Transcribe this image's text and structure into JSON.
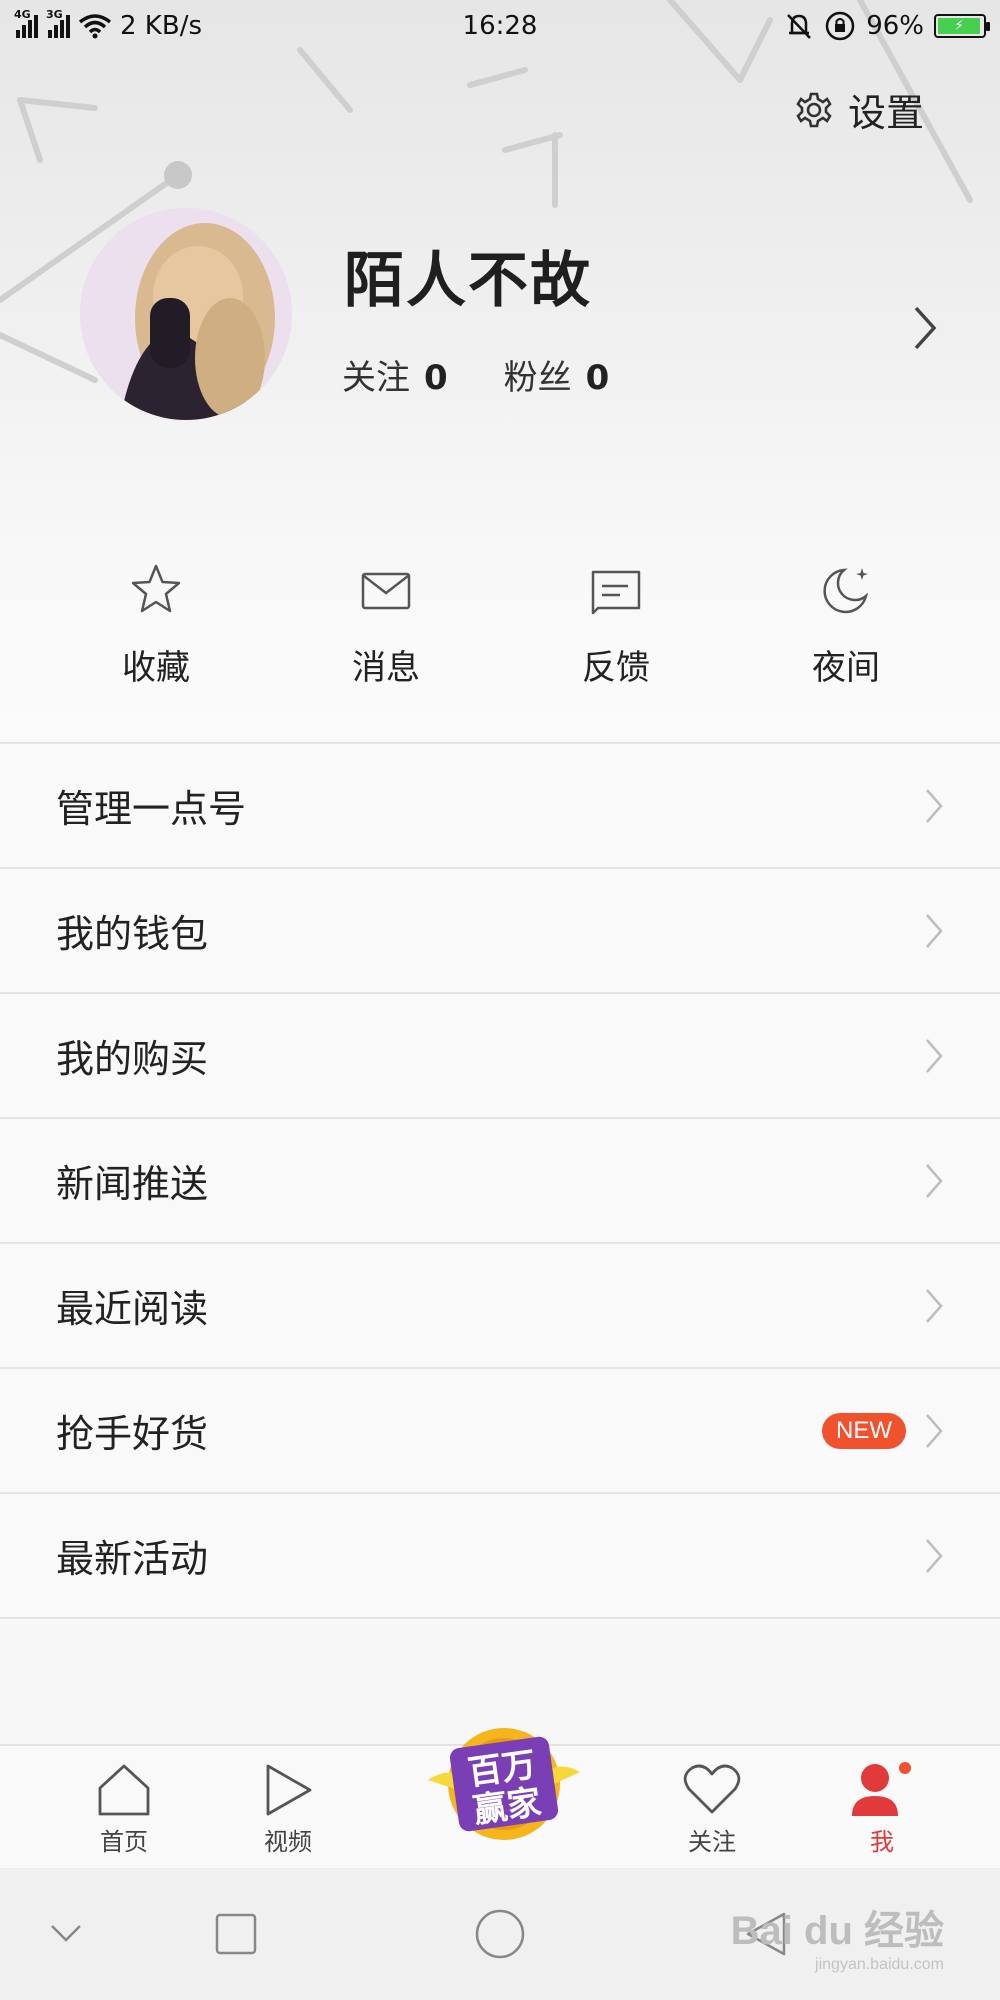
{
  "status_bar": {
    "network_1": "4G",
    "network_2": "3G",
    "speed": "2 KB/s",
    "time": "16:28",
    "battery": "96%"
  },
  "header": {
    "settings_label": "设置"
  },
  "profile": {
    "username": "陌人不故",
    "following_label": "关注",
    "following_count": "0",
    "fans_label": "粉丝",
    "fans_count": "0"
  },
  "quick_actions": [
    {
      "label": "收藏",
      "icon": "star-icon"
    },
    {
      "label": "消息",
      "icon": "mail-icon"
    },
    {
      "label": "反馈",
      "icon": "feedback-icon"
    },
    {
      "label": "夜间",
      "icon": "moon-icon"
    }
  ],
  "menu": [
    {
      "label": "管理一点号"
    },
    {
      "label": "我的钱包"
    },
    {
      "label": "我的购买"
    },
    {
      "label": "新闻推送"
    },
    {
      "label": "最近阅读"
    },
    {
      "label": "抢手好货",
      "badge": "NEW"
    },
    {
      "label": "最新活动"
    }
  ],
  "tab_bar": {
    "home": "首页",
    "video": "视频",
    "promo_line1": "百万",
    "promo_line2": "赢家",
    "follow": "关注",
    "me": "我"
  },
  "watermark": {
    "text": "Bai du 经验",
    "sub": "jingyan.baidu.com"
  },
  "colors": {
    "accent": "#e03a3a",
    "badge": "#f0522d",
    "battery": "#46d04f"
  }
}
